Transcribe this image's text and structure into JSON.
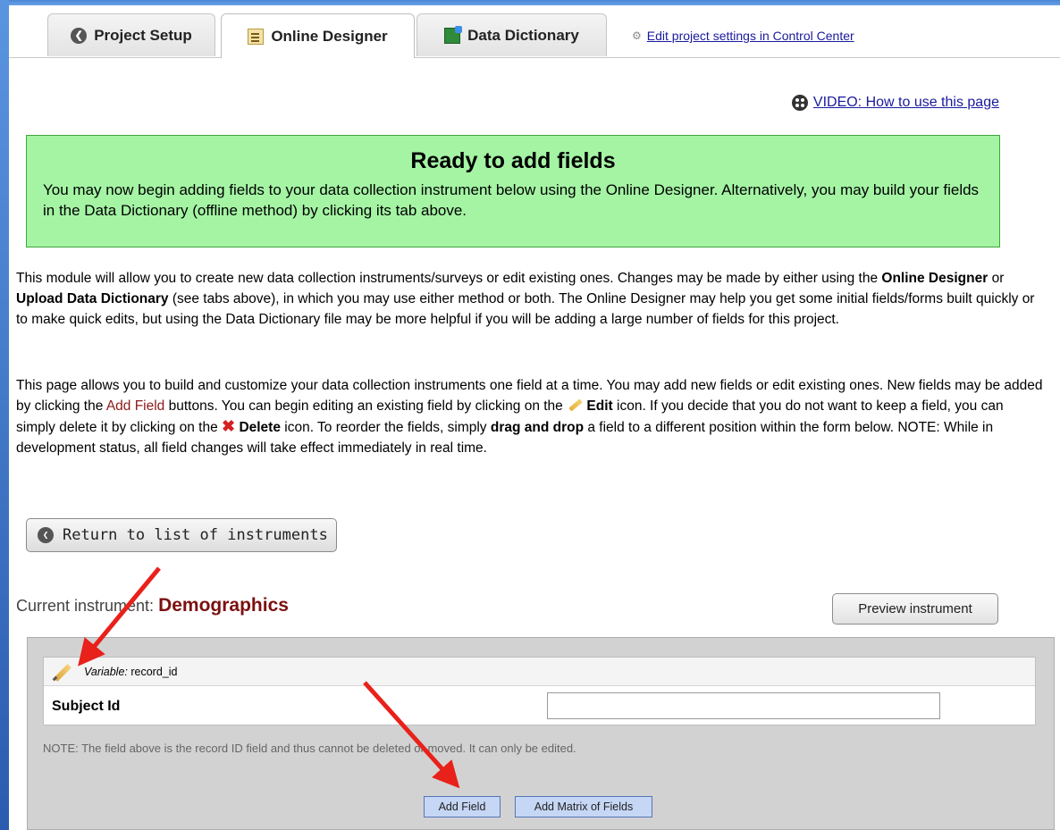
{
  "tabs": [
    {
      "label": "Project Setup",
      "icon": "back-circle-icon"
    },
    {
      "label": "Online Designer",
      "icon": "designer-icon"
    },
    {
      "label": "Data Dictionary",
      "icon": "spreadsheet-icon"
    }
  ],
  "settings_link": "Edit project settings in Control Center",
  "video_link": "VIDEO: How to use this page",
  "ready_box": {
    "title": "Ready to add fields",
    "text": "You may now begin adding fields to your data collection instrument below using the Online Designer. Alternatively, you may build your fields in the Data Dictionary (offline method) by clicking its tab above."
  },
  "para1": {
    "t1": "This module will allow you to create new data collection instruments/surveys or edit existing ones. Changes may be made by either using the ",
    "b1": "Online Designer",
    "t2": " or ",
    "b2": "Upload Data Dictionary",
    "t3": " (see tabs above), in which you may use either method or both. The Online Designer may help you get some initial fields/forms built quickly or to make quick edits, but using the Data Dictionary file may be more helpful if you will be adding a large number of fields for this project."
  },
  "para2": {
    "t1": "This page allows you to build and customize your data collection instruments one field at a time. You may add new fields or edit existing ones. New fields may be added by clicking the ",
    "add_field": "Add Field",
    "t2": " buttons. You can begin editing an existing field by clicking on the ",
    "edit": "Edit",
    "t3": " icon. If you decide that you do not want to keep a field, you can simply delete it by clicking on the ",
    "delete": "Delete",
    "t4": " icon. To reorder the fields, simply ",
    "drag": "drag and drop",
    "t5": " a field to a different position within the form below. NOTE: While in development status, all field changes will take effect immediately in real time."
  },
  "return_button": "Return to list of instruments",
  "current_instrument": {
    "label": "Current instrument:",
    "name": "Demographics"
  },
  "preview_button": "Preview instrument",
  "field": {
    "variable_label": "Variable:",
    "variable_name": "record_id",
    "label": "Subject Id",
    "value": ""
  },
  "note": "NOTE: The field above is the record ID field and thus cannot be deleted or moved. It can only be edited.",
  "add_field_button": "Add Field",
  "add_matrix_button": "Add Matrix of Fields",
  "colors": {
    "ready_bg": "#a4f4a4",
    "instrument_name": "#7b1010",
    "arrow": "#e8211a"
  }
}
